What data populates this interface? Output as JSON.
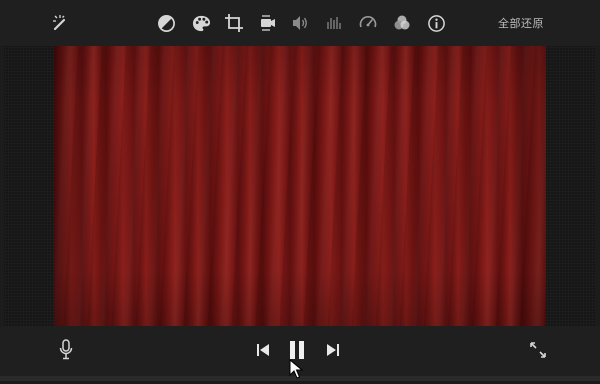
{
  "toolbar": {
    "tools": [
      {
        "name": "magic-wand-icon",
        "tooltip": ""
      },
      {
        "name": "color-balance-icon"
      },
      {
        "name": "palette-icon"
      },
      {
        "name": "crop-icon"
      },
      {
        "name": "stabilization-camera-icon"
      },
      {
        "name": "volume-icon"
      },
      {
        "name": "equalizer-icon"
      },
      {
        "name": "speed-icon"
      },
      {
        "name": "clip-filter-icon"
      },
      {
        "name": "info-icon"
      }
    ],
    "restore_label": "全部还原"
  },
  "viewer": {
    "content": "red-curtain"
  },
  "controls": {
    "items": [
      "microphone-icon",
      "skip-back-icon",
      "pause-icon",
      "skip-forward-icon",
      "fullscreen-icon"
    ]
  },
  "colors": {
    "toolbar_bg": "#1f1f20",
    "icon": "#d6d6d6",
    "icon_dim": "#8a8a8a",
    "curtain": "#7f1a17"
  }
}
